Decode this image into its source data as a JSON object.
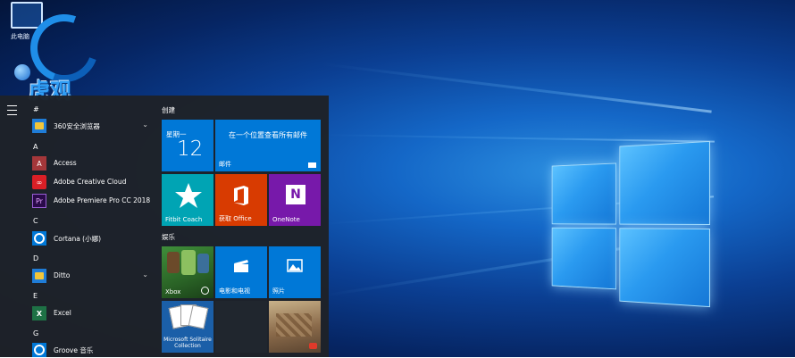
{
  "watermark": {
    "pc_label": "此电脑",
    "brand": "虎观"
  },
  "start_menu": {
    "apps": [
      {
        "group": "#",
        "name": "360安全浏览器",
        "icon": "folder-icon",
        "expandable": true
      },
      {
        "group": "A",
        "name": "Access",
        "icon": "access-icon"
      },
      {
        "group": "",
        "name": "Adobe Creative Cloud",
        "icon": "creative-cloud-icon"
      },
      {
        "group": "",
        "name": "Adobe Premiere Pro CC 2018",
        "icon": "premiere-icon",
        "glyph": "Pr"
      },
      {
        "group": "C",
        "name": "Cortana (小娜)",
        "icon": "cortana-icon"
      },
      {
        "group": "D",
        "name": "Ditto",
        "icon": "folder-icon",
        "expandable": true
      },
      {
        "group": "E",
        "name": "Excel",
        "icon": "excel-icon",
        "glyph": "X"
      },
      {
        "group": "G",
        "name": "Groove 音乐",
        "icon": "groove-icon"
      }
    ],
    "sections": {
      "create": "创建",
      "entertainment": "娱乐"
    },
    "tiles": {
      "calendar": {
        "day": "星期一",
        "date": "12"
      },
      "mail": {
        "message": "在一个位置查看所有邮件",
        "label": "邮件"
      },
      "fitbit": {
        "label": "Fitbit Coach"
      },
      "office": {
        "label": "获取 Office"
      },
      "onenote": {
        "label": "OneNote"
      },
      "xbox": {
        "label": "Xbox"
      },
      "movies": {
        "label": "电影和电视"
      },
      "photos": {
        "label": "照片"
      },
      "solitaire": {
        "label": "Microsoft Solitaire Collection"
      }
    }
  },
  "colors": {
    "tile_blue": "#0078d7",
    "office_orange": "#d83b01",
    "onenote_purple": "#7719aa",
    "xbox_green": "#107c10",
    "menu_bg": "#1e2228"
  }
}
